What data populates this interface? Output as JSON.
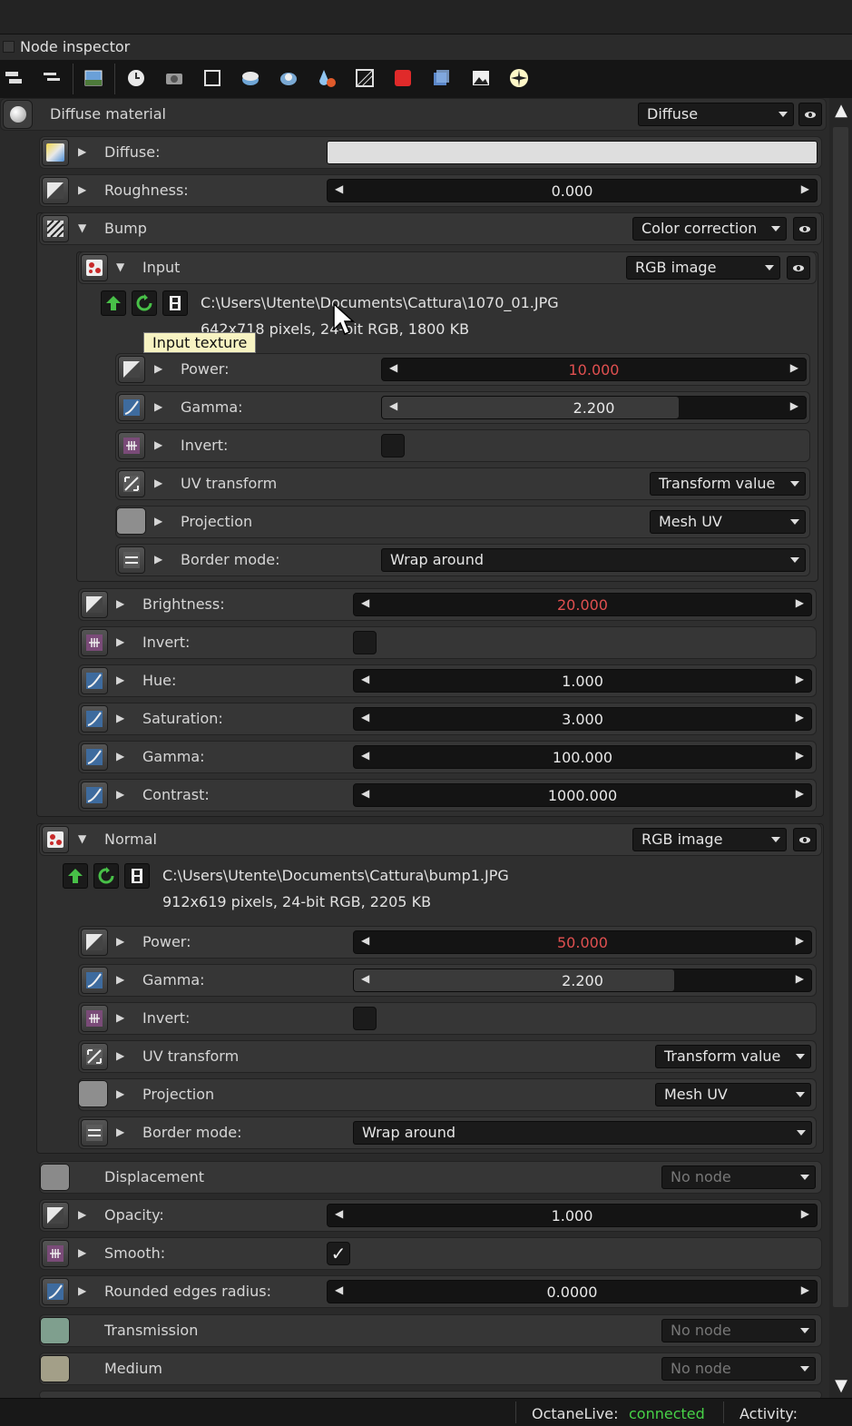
{
  "panel": {
    "title": "Node inspector"
  },
  "toolbar": {
    "icons": [
      "layers-icon",
      "list-icon",
      "image-icon",
      "clock-icon",
      "camera-icon",
      "frame-icon",
      "mesh-icon",
      "geometry-icon",
      "paint-icon",
      "texture-icon",
      "material-icon",
      "cube-icon",
      "picture-icon",
      "light-icon"
    ]
  },
  "root": {
    "label": "Diffuse material",
    "type": "Diffuse"
  },
  "pins": {
    "diffuse": {
      "label": "Diffuse:"
    },
    "roughness": {
      "label": "Roughness:",
      "value": "0.000"
    },
    "bump": {
      "label": "Bump",
      "type": "Color correction",
      "input": {
        "label": "Input",
        "type": "RGB image",
        "path": "C:\\Users\\Utente\\Documents\\Cattura\\1070_01.JPG",
        "info": "642x718 pixels, 24-bit RGB, 1800 KB",
        "tooltip": "Input texture",
        "power": {
          "label": "Power:",
          "value": "10.000"
        },
        "gamma": {
          "label": "Gamma:",
          "value": "2.200"
        },
        "invert": {
          "label": "Invert:"
        },
        "uv": {
          "label": "UV transform",
          "value": "Transform value"
        },
        "projection": {
          "label": "Projection",
          "value": "Mesh UV"
        },
        "border": {
          "label": "Border mode:",
          "value": "Wrap around"
        }
      },
      "brightness": {
        "label": "Brightness:",
        "value": "20.000"
      },
      "invert": {
        "label": "Invert:"
      },
      "hue": {
        "label": "Hue:",
        "value": "1.000"
      },
      "saturation": {
        "label": "Saturation:",
        "value": "3.000"
      },
      "gamma": {
        "label": "Gamma:",
        "value": "100.000"
      },
      "contrast": {
        "label": "Contrast:",
        "value": "1000.000"
      }
    },
    "normal": {
      "label": "Normal",
      "type": "RGB image",
      "path": "C:\\Users\\Utente\\Documents\\Cattura\\bump1.JPG",
      "info": "912x619 pixels, 24-bit RGB, 2205 KB",
      "power": {
        "label": "Power:",
        "value": "50.000"
      },
      "gamma": {
        "label": "Gamma:",
        "value": "2.200"
      },
      "invert": {
        "label": "Invert:"
      },
      "uv": {
        "label": "UV transform",
        "value": "Transform value"
      },
      "projection": {
        "label": "Projection",
        "value": "Mesh UV"
      },
      "border": {
        "label": "Border mode:",
        "value": "Wrap around"
      }
    },
    "displacement": {
      "label": "Displacement",
      "value": "No node"
    },
    "opacity": {
      "label": "Opacity:",
      "value": "1.000"
    },
    "smooth": {
      "label": "Smooth:",
      "checked": true
    },
    "rounded": {
      "label": "Rounded edges radius:",
      "value": "0.0000"
    },
    "transmission": {
      "label": "Transmission",
      "value": "No node"
    },
    "medium": {
      "label": "Medium",
      "value": "No node"
    }
  },
  "status": {
    "octane_label": "OctaneLive:",
    "octane_state": "connected",
    "activity_label": "Activity:"
  },
  "colors": {
    "accent_red": "#e05050",
    "connected_green": "#47d147"
  }
}
